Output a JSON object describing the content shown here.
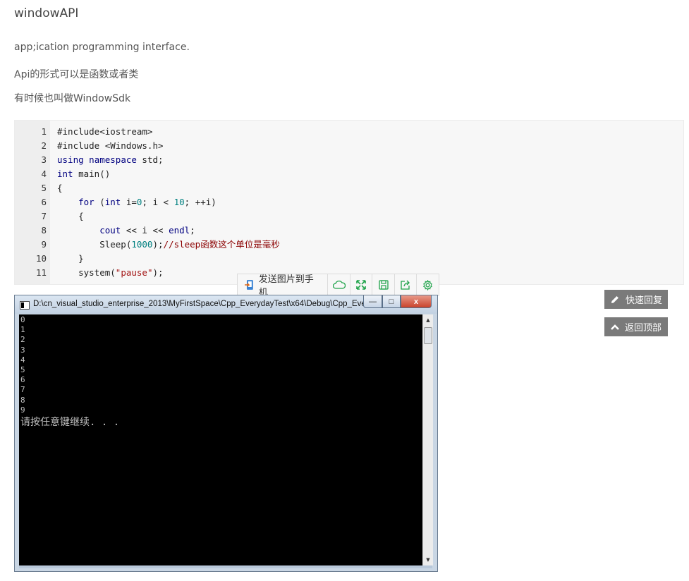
{
  "article": {
    "title": "windowAPI",
    "paragraphs": [
      "app;ication programming interface.",
      "Api的形式可以是函数或者类",
      "有时候也叫做WindowSdk"
    ]
  },
  "code": {
    "line_numbers": [
      "1",
      "2",
      "3",
      "4",
      "5",
      "6",
      "7",
      "8",
      "9",
      "10",
      "11"
    ],
    "lines": [
      "#include<iostream>",
      "#include <Windows.h>",
      "using namespace std;",
      "int main()",
      "{",
      "    for (int i=0; i < 10; ++i)",
      "    {",
      "        cout << i << endl;",
      "        Sleep(1000);//sleep函数这个单位是毫秒",
      "    }",
      "    system(\"pause\");"
    ]
  },
  "image_toolbar": {
    "send_label": "发送图片到手机",
    "icons": [
      "phone-send-icon",
      "cloud-icon",
      "fullscreen-icon",
      "save-icon",
      "share-icon",
      "gear-icon"
    ]
  },
  "side_buttons": {
    "quick_reply": "快速回复",
    "back_to_top": "返回顶部"
  },
  "console_window": {
    "title": "D:\\cn_visual_studio_enterprise_2013\\MyFirstSpace\\Cpp_EverydayTest\\x64\\Debug\\Cpp_Eve...",
    "output_lines": [
      "0",
      "1",
      "2",
      "3",
      "4",
      "5",
      "6",
      "7",
      "8",
      "9"
    ],
    "prompt": "请按任意键继续. . .",
    "min_label": "—",
    "max_label": "□",
    "close_label": "x"
  },
  "colors": {
    "accent_green": "#1fa34a",
    "side_button_bg": "#7a7a7a",
    "code_bg": "#f7f7f7"
  }
}
